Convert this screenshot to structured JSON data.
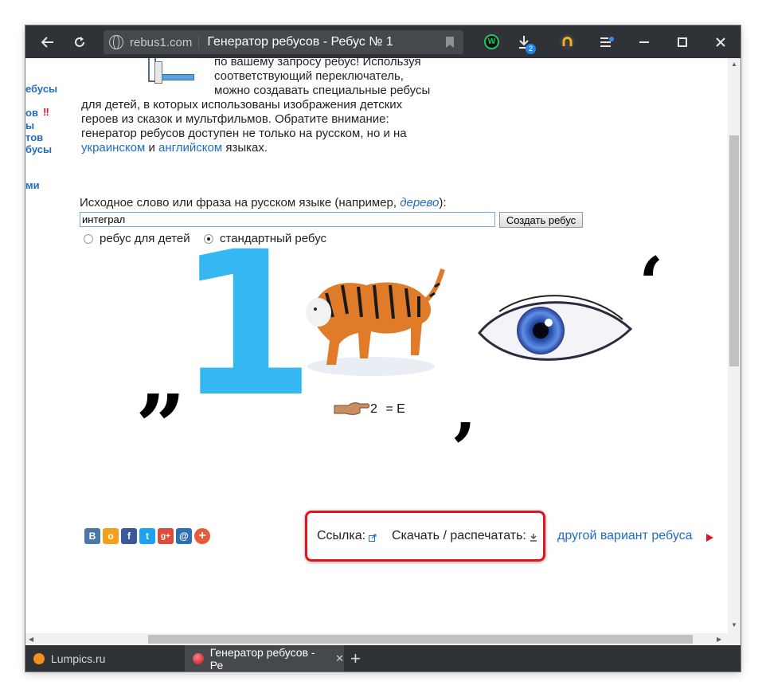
{
  "browser": {
    "domain": "rebus1.com",
    "page_title": "Генератор ребусов - Ребус № 1",
    "download_count": "2"
  },
  "tabs": [
    {
      "label": "Lumpics.ru"
    },
    {
      "label": "Генератор ребусов - Ре",
      "close": "✕"
    }
  ],
  "new_tab": "+",
  "sidebar": {
    "items": [
      "ебусы",
      "ов",
      "‼",
      "ы",
      "тов",
      "бусы",
      "ми"
    ]
  },
  "intro": {
    "line1": "по вашему запросу ребус! Используя",
    "line2": "соответствующий переключатель,",
    "line3": "можно создавать специальные ребусы",
    "line4": "для детей, в которых использованы изображения детских",
    "line5": "героев из сказок и мультфильмов. Обратите внимание:",
    "line6": "генератор ребусов доступен не только на русском, но и на",
    "link_ua": "украинском",
    "and": "и",
    "link_en": "английском",
    "tail": "языках."
  },
  "form": {
    "label": "Исходное слово или фраза на русском языке (например,",
    "example": "дерево",
    "label_end": "):",
    "input_value": "интеграл",
    "submit": "Создать ребус",
    "radio_kids": "ребус для детей",
    "radio_std": "стандартный ребус"
  },
  "rebus": {
    "digit": "1",
    "open_quote": "„",
    "comma1": "‚",
    "comma2": "‘",
    "finger_rule": "2",
    "equals_rule": "= E"
  },
  "actions": {
    "link_label": "Ссылка:",
    "download_label": "Скачать / распечатать:",
    "other_variant": "другой вариант ребуса"
  },
  "social": [
    "В",
    "о",
    "f",
    "t",
    "g+",
    "@",
    "+"
  ],
  "colors": {
    "chrome": "#2f3237",
    "link": "#1f6dc2",
    "digit": "#35b8f2",
    "highlight": "#e3141f"
  }
}
